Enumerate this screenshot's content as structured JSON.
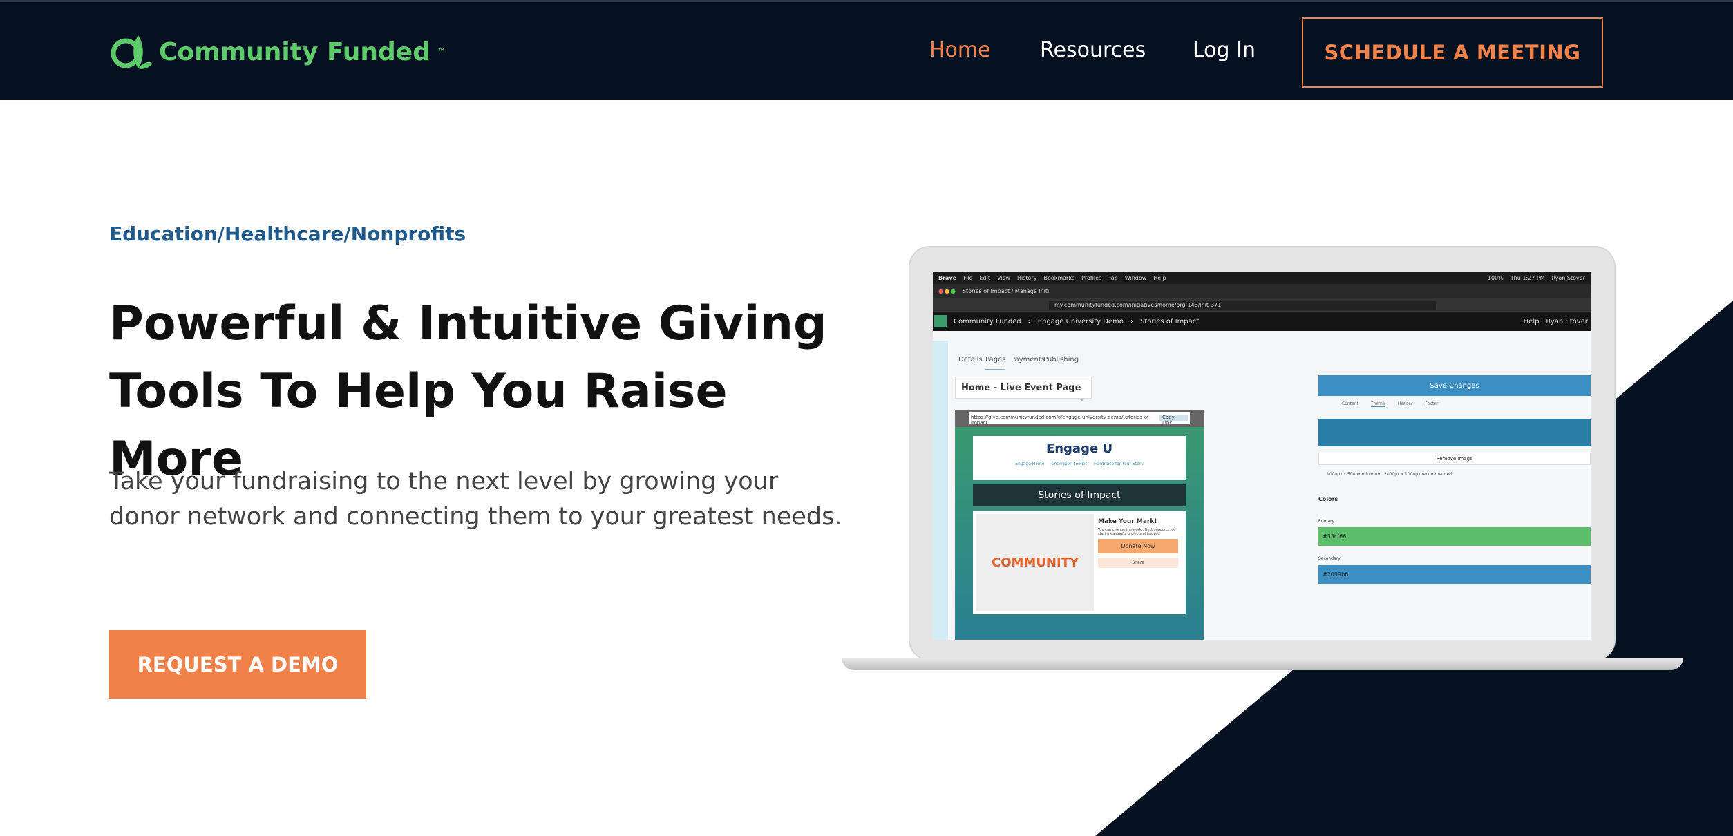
{
  "header": {
    "logo": "Community Funded",
    "logo_tm": "™",
    "nav": [
      {
        "label": "Home",
        "active": true
      },
      {
        "label": "Resources"
      },
      {
        "label": "Log In"
      }
    ],
    "cta": "SCHEDULE A MEETING"
  },
  "hero": {
    "tagline": "Education/Healthcare/Nonprofits",
    "title_line1": "Powerful & Intuitive Giving",
    "title_line2": "Tools To Help You Raise More",
    "description": "Take your fundraising to the next level by growing your donor network and connecting them to your greatest needs.",
    "cta": "REQUEST A DEMO"
  },
  "colors": {
    "accent": "#f08149",
    "nav_bg": "#061222",
    "brand_green": "#5ecb6a",
    "tagline": "#1f5a8a"
  },
  "screen": {
    "menubar": [
      "Brave",
      "File",
      "Edit",
      "View",
      "History",
      "Bookmarks",
      "Profiles",
      "Tab",
      "Window",
      "Help"
    ],
    "clock": "Thu 1:27 PM",
    "user": "Ryan Stover",
    "battery": "100%",
    "tab_title": "Stories of Impact / Manage Initi",
    "url": "my.communityfunded.com/initiatives/home/org-148/init-371",
    "breadcrumb": [
      "Community Funded",
      "Engage University Demo",
      "Stories of Impact"
    ],
    "help": "Help",
    "tabs": [
      "Details",
      "Pages",
      "Payments",
      "Publishing"
    ],
    "page_select": "Home - Live Event Page",
    "save": "Save Changes",
    "preview_url": "https://give.communityfunded.com/o/engage-university-demo/i/stories-of-impact",
    "copy_link": "Copy Link",
    "brand": "Engage U",
    "site_nav": [
      "Engage Home",
      "Champion Toolkit",
      "Fundraise for Your Story"
    ],
    "banner": "Stories of Impact",
    "card_title": "Make Your Mark!",
    "card_text": "You can change the world. Find, support... or start meaningful projects of impact.",
    "donate": "Donate Now",
    "share": "Share",
    "heart_word": "COMMUNITY",
    "theme_tabs": [
      "Content",
      "Theme",
      "Header",
      "Footer"
    ],
    "remove_image": "Remove Image",
    "image_hint": "1000px x 500px minimum. 2000px x 1000px recommended.",
    "colors_label": "Colors",
    "primary_label": "Primary",
    "primary": "#33cf66",
    "secondary_label": "Secondary",
    "secondary": "#2099b6"
  }
}
